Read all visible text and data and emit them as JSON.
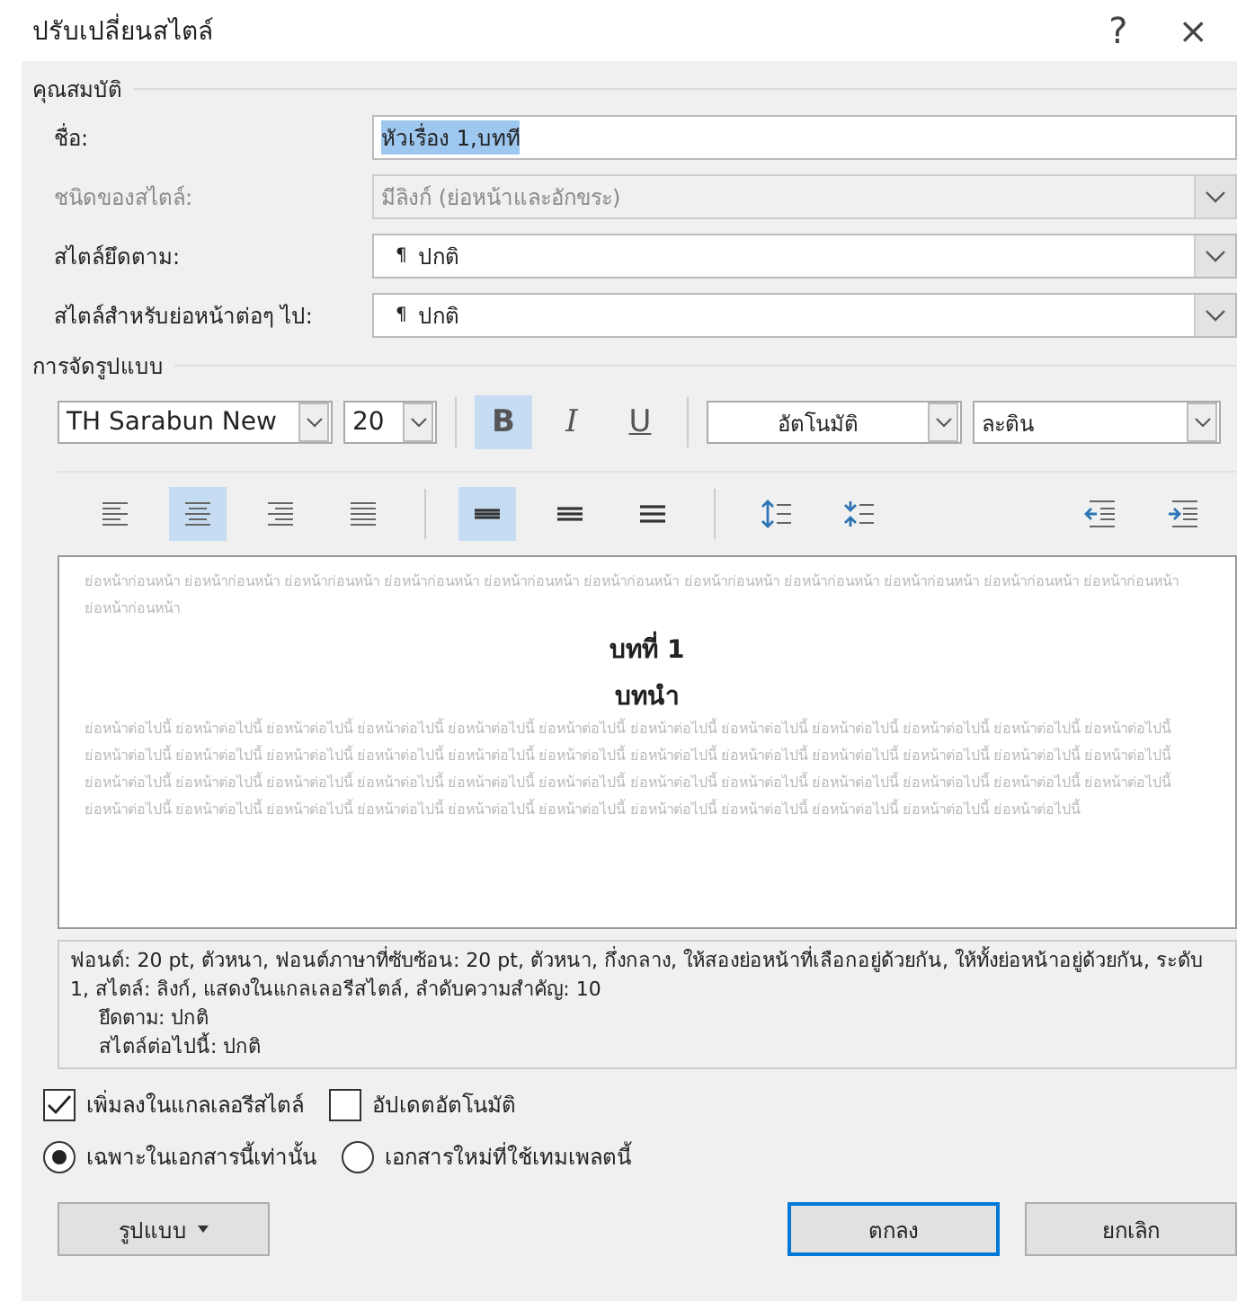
{
  "window": {
    "title": "ปรับเปลี่ยนสไตล์",
    "help": "?",
    "close": "×"
  },
  "properties": {
    "heading": "คุณสมบัติ",
    "rows": [
      {
        "kind": "text",
        "label": "ชื่อ:",
        "value": "หัวเรื่อง 1,บทที",
        "disabled": false,
        "selected": true
      },
      {
        "kind": "select",
        "label": "ชนิดของสไตล์:",
        "value": "มีลิงก์ (ย่อหน้าและอักขระ)",
        "disabled": true,
        "mark": ""
      },
      {
        "kind": "select",
        "label": "สไตล์ยึดตาม:",
        "value": "ปกติ",
        "disabled": false,
        "mark": "¶"
      },
      {
        "kind": "select",
        "label": "สไตล์สำหรับย่อหน้าต่อๆ ไป:",
        "value": "ปกติ",
        "disabled": false,
        "mark": "¶"
      }
    ]
  },
  "formatting": {
    "heading": "การจัดรูปแบบ",
    "font": "TH Sarabun New",
    "size": "20",
    "styles": [
      {
        "kind": "bold",
        "label": "B",
        "selected": true
      },
      {
        "kind": "italic",
        "label": "I",
        "selected": false
      },
      {
        "kind": "underline",
        "label": "U",
        "selected": false
      }
    ],
    "font_color": "อัตโนมัติ",
    "script": "ละติน",
    "alignment": [
      {
        "kind": "left",
        "selected": false
      },
      {
        "kind": "center",
        "selected": true
      },
      {
        "kind": "right",
        "selected": false
      },
      {
        "kind": "justify",
        "selected": false
      }
    ],
    "spacing": [
      {
        "kind": "single",
        "selected": true
      },
      {
        "kind": "onehalf",
        "selected": false
      },
      {
        "kind": "double",
        "selected": false
      }
    ],
    "paragraph": [
      {
        "kind": "increase"
      },
      {
        "kind": "decrease"
      }
    ],
    "indent": [
      {
        "kind": "decrease"
      },
      {
        "kind": "increase"
      }
    ]
  },
  "preview": {
    "before": "ย่อหน้าก่อนหน้า ย่อหน้าก่อนหน้า ย่อหน้าก่อนหน้า ย่อหน้าก่อนหน้า ย่อหน้าก่อนหน้า ย่อหน้าก่อนหน้า ย่อหน้าก่อนหน้า ย่อหน้าก่อนหน้า ย่อหน้าก่อนหน้า ย่อหน้าก่อนหน้า ย่อหน้าก่อนหน้า ย่อหน้าก่อนหน้า",
    "headings": [
      "บทที่ 1",
      "บทนำ"
    ],
    "after": "ย่อหน้าต่อไปนี้ ย่อหน้าต่อไปนี้ ย่อหน้าต่อไปนี้ ย่อหน้าต่อไปนี้ ย่อหน้าต่อไปนี้ ย่อหน้าต่อไปนี้ ย่อหน้าต่อไปนี้ ย่อหน้าต่อไปนี้ ย่อหน้าต่อไปนี้ ย่อหน้าต่อไปนี้ ย่อหน้าต่อไปนี้ ย่อหน้าต่อไปนี้ ย่อหน้าต่อไปนี้ ย่อหน้าต่อไปนี้ ย่อหน้าต่อไปนี้ ย่อหน้าต่อไปนี้ ย่อหน้าต่อไปนี้ ย่อหน้าต่อไปนี้ ย่อหน้าต่อไปนี้ ย่อหน้าต่อไปนี้ ย่อหน้าต่อไปนี้ ย่อหน้าต่อไปนี้ ย่อหน้าต่อไปนี้ ย่อหน้าต่อไปนี้ ย่อหน้าต่อไปนี้ ย่อหน้าต่อไปนี้ ย่อหน้าต่อไปนี้ ย่อหน้าต่อไปนี้ ย่อหน้าต่อไปนี้ ย่อหน้าต่อไปนี้ ย่อหน้าต่อไปนี้ ย่อหน้าต่อไปนี้ ย่อหน้าต่อไปนี้ ย่อหน้าต่อไปนี้ ย่อหน้าต่อไปนี้ ย่อหน้าต่อไปนี้ ย่อหน้าต่อไปนี้ ย่อหน้าต่อไปนี้ ย่อหน้าต่อไปนี้ ย่อหน้าต่อไปนี้ ย่อหน้าต่อไปนี้ ย่อหน้าต่อไปนี้ ย่อหน้าต่อไปนี้ ย่อหน้าต่อไปนี้ ย่อหน้าต่อไปนี้ ย่อหน้าต่อไปนี้ ย่อหน้าต่อไปนี้"
  },
  "description": {
    "summary": "ฟอนต์: 20 pt, ตัวหนา, ฟอนต์ภาษาที่ซับซ้อน: 20 pt, ตัวหนา, กึ่งกลาง, ให้สองย่อหน้าที่เลือกอยู่ด้วยกัน, ให้ทั้งย่อหน้าอยู่ด้วยกัน, ระดับ 1, สไตล์: ลิงก์, แสดงในแกลเลอรีสไตล์, ลำดับความสำคัญ: 10",
    "details": [
      "ยึดตาม: ปกติ",
      "สไตล์ต่อไปนี้: ปกติ"
    ]
  },
  "options": {
    "checkboxes": [
      {
        "label": "เพิ่มลงในแกลเลอรีสไตล์",
        "checked": true
      },
      {
        "label": "อัปเดตอัตโนมัติ",
        "checked": false
      }
    ],
    "radios": [
      {
        "label": "เฉพาะในเอกสารนี้เท่านั้น",
        "selected": true
      },
      {
        "label": "เอกสารใหม่ที่ใช้เทมเพลตนี้",
        "selected": false
      }
    ]
  },
  "buttons": {
    "format": "รูปแบบ",
    "ok": "ตกลง",
    "cancel": "ยกเลิก"
  }
}
